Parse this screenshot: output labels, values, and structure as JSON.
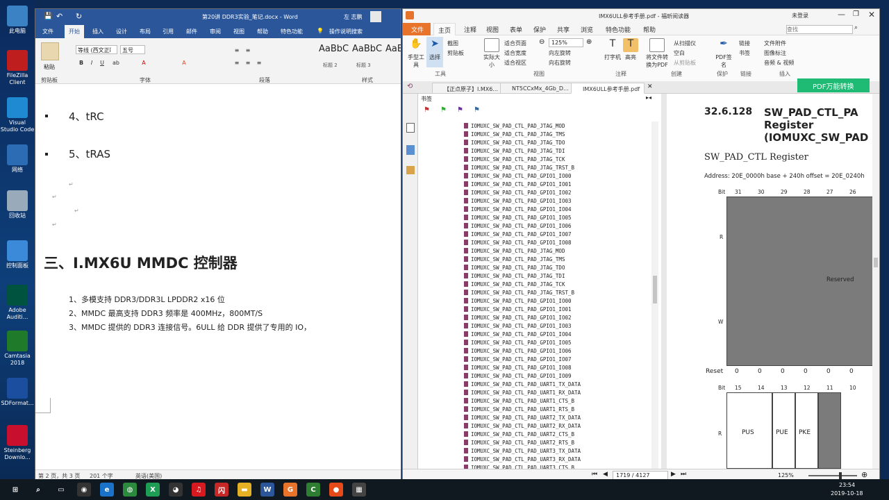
{
  "desktop": {
    "icons": [
      {
        "label": "此电脑",
        "icon": "computer-icon",
        "color": "#3b82c4"
      },
      {
        "label": "FileZilla Client",
        "icon": "filezilla-icon",
        "color": "#bf1e1e"
      },
      {
        "label": "Visual Studio Code",
        "icon": "vscode-icon",
        "color": "#1f8ad2"
      },
      {
        "label": "网络",
        "icon": "network-icon",
        "color": "#2b6cb5"
      },
      {
        "label": "回收站",
        "icon": "recycle-bin-icon",
        "color": "#9ab"
      },
      {
        "label": "控制面板",
        "icon": "control-panel-icon",
        "color": "#3a8ad9"
      },
      {
        "label": "Adobe Auditi...",
        "icon": "audition-icon",
        "color": "#00543f"
      },
      {
        "label": "Camtasia 2018",
        "icon": "camtasia-icon",
        "color": "#1f7a2a"
      },
      {
        "label": "SDFormat...",
        "icon": "sdformatter-icon",
        "color": "#1c4ea0"
      },
      {
        "label": "Steinberg Downlo...",
        "icon": "steinberg-icon",
        "color": "#c8102e"
      }
    ]
  },
  "word": {
    "title": "第20讲 DDR3实验_笔记.docx - Word",
    "user": "左 志鹏",
    "tabs": [
      "文件",
      "开始",
      "插入",
      "设计",
      "布局",
      "引用",
      "邮件",
      "审阅",
      "视图",
      "帮助",
      "特色功能"
    ],
    "tell_me": "操作说明搜索",
    "ribbon": {
      "paste_label": "粘贴",
      "clipboard_group": "剪贴板",
      "font_name": "等线 (西文正ǐ",
      "font_size": "五号",
      "font_group": "字体",
      "paragraph_group": "段落",
      "styles_group": "样式",
      "styles": [
        {
          "preview": "AaBbC",
          "name": "标题 2"
        },
        {
          "preview": "AaBbC",
          "name": "标题 3"
        },
        {
          "preview": "AaBb",
          "name": ""
        }
      ]
    },
    "doc": {
      "item4": "4、tRC",
      "item5": "5、tRAS",
      "heading": "三、I.MX6U MMDC 控制器",
      "line1": "1、多模支持 DDR3/DDR3L LPDDR2 x16 位",
      "line2": "2、MMDC 最高支持 DDR3 频率是 400MHz，800MT/S",
      "line3": "3、MMDC 提供的 DDR3 连接信号。6ULL 给 DDR 提供了专用的 IO，"
    },
    "status": {
      "page": "第 2 页，共 3 页",
      "words": "201 个字",
      "lang": "英语(美国)"
    }
  },
  "foxit": {
    "title": "IMX6ULL参考手册.pdf - 福昕阅读器",
    "login": "未登录",
    "menu": [
      "文件",
      "主页",
      "注释",
      "视图",
      "表单",
      "保护",
      "共享",
      "浏览",
      "特色功能",
      "帮助"
    ],
    "search_placeholder": "查找",
    "ribbon": {
      "hand": "手型工具",
      "select": "选择",
      "screenshot": "截图",
      "clipboard": "剪贴板",
      "actual_size": "实际大小",
      "fit_page": "适合页面",
      "fit_width": "适合宽度",
      "fit_view": "适合视区",
      "zoom": "125%",
      "rotate_left": "向左旋转",
      "rotate_right": "向右旋转",
      "typewriter": "打字机",
      "highlight": "高亮",
      "to_pdf": "将文件转换为PDF",
      "from_scanner": "从扫描仪",
      "blank": "空白",
      "from_clipboard": "从剪贴板",
      "pdf_sign": "PDF签名",
      "link": "链接",
      "bookmark": "书签",
      "file_attach": "文件附件",
      "image_annot": "图像标注",
      "audio_video": "音频 & 视频",
      "groups": [
        "工具",
        "视图",
        "注释",
        "创建",
        "保护",
        "链接",
        "插入"
      ]
    },
    "doc_tabs": [
      "【正点原子】I.MX6...",
      "NT5CCxMx_4Gb_D...",
      "IMX6ULL参考手册.pdf"
    ],
    "convert_button": "PDF万能转换",
    "bookmarks_label": "书签",
    "bookmarks": [
      "IOMUXC_SW_PAD_CTL_PAD_JTAG_MOD",
      "IOMUXC_SW_PAD_CTL_PAD_JTAG_TMS",
      "IOMUXC_SW_PAD_CTL_PAD_JTAG_TDO",
      "IOMUXC_SW_PAD_CTL_PAD_JTAG_TDI",
      "IOMUXC_SW_PAD_CTL_PAD_JTAG_TCK",
      "IOMUXC_SW_PAD_CTL_PAD_JTAG_TRST_B",
      "IOMUXC_SW_PAD_CTL_PAD_GPIO1_IO00",
      "IOMUXC_SW_PAD_CTL_PAD_GPIO1_IO01",
      "IOMUXC_SW_PAD_CTL_PAD_GPIO1_IO02",
      "IOMUXC_SW_PAD_CTL_PAD_GPIO1_IO03",
      "IOMUXC_SW_PAD_CTL_PAD_GPIO1_IO04",
      "IOMUXC_SW_PAD_CTL_PAD_GPIO1_IO05",
      "IOMUXC_SW_PAD_CTL_PAD_GPIO1_IO06",
      "IOMUXC_SW_PAD_CTL_PAD_GPIO1_IO07",
      "IOMUXC_SW_PAD_CTL_PAD_GPIO1_IO08",
      "IOMUXC_SW_PAD_CTL_PAD_JTAG_MOD",
      "IOMUXC_SW_PAD_CTL_PAD_JTAG_TMS",
      "IOMUXC_SW_PAD_CTL_PAD_JTAG_TDO",
      "IOMUXC_SW_PAD_CTL_PAD_JTAG_TDI",
      "IOMUXC_SW_PAD_CTL_PAD_JTAG_TCK",
      "IOMUXC_SW_PAD_CTL_PAD_JTAG_TRST_B",
      "IOMUXC_SW_PAD_CTL_PAD_GPIO1_IO00",
      "IOMUXC_SW_PAD_CTL_PAD_GPIO1_IO01",
      "IOMUXC_SW_PAD_CTL_PAD_GPIO1_IO02",
      "IOMUXC_SW_PAD_CTL_PAD_GPIO1_IO03",
      "IOMUXC_SW_PAD_CTL_PAD_GPIO1_IO04",
      "IOMUXC_SW_PAD_CTL_PAD_GPIO1_IO05",
      "IOMUXC_SW_PAD_CTL_PAD_GPIO1_IO06",
      "IOMUXC_SW_PAD_CTL_PAD_GPIO1_IO07",
      "IOMUXC_SW_PAD_CTL_PAD_GPIO1_IO08",
      "IOMUXC_SW_PAD_CTL_PAD_GPIO1_IO09",
      "IOMUXC_SW_PAD_CTL_PAD_UART1_TX_DATA",
      "IOMUXC_SW_PAD_CTL_PAD_UART1_RX_DATA",
      "IOMUXC_SW_PAD_CTL_PAD_UART1_CTS_B",
      "IOMUXC_SW_PAD_CTL_PAD_UART1_RTS_B",
      "IOMUXC_SW_PAD_CTL_PAD_UART2_TX_DATA",
      "IOMUXC_SW_PAD_CTL_PAD_UART2_RX_DATA",
      "IOMUXC_SW_PAD_CTL_PAD_UART2_CTS_B",
      "IOMUXC_SW_PAD_CTL_PAD_UART2_RTS_B",
      "IOMUXC_SW_PAD_CTL_PAD_UART3_TX_DATA",
      "IOMUXC_SW_PAD_CTL_PAD_UART3_RX_DATA",
      "IOMUXC_SW_PAD_CTL_PAD_UART3_CTS_B"
    ],
    "page": {
      "section": "32.6.128",
      "title_l1": "SW_PAD_CTL_PA",
      "title_l2": "Register",
      "title_l3": "(IOMUXC_SW_PAD",
      "subtitle": "SW_PAD_CTL Register",
      "address": "Address: 20E_0000h base + 240h offset = 20E_0240h",
      "bit_label": "Bit",
      "bits_top": [
        "31",
        "30",
        "29",
        "28",
        "27",
        "26"
      ],
      "r_label": "R",
      "w_label": "W",
      "reserved": "Reserved",
      "reset_label": "Reset",
      "reset_values": [
        "0",
        "0",
        "0",
        "0",
        "0",
        "0"
      ],
      "bits_bottom": [
        "15",
        "14",
        "13",
        "12",
        "11",
        "10"
      ],
      "fields": [
        "PUS",
        "PUE",
        "PKE"
      ]
    },
    "status": {
      "page_indicator": "1719 / 4127",
      "zoom": "125%"
    }
  },
  "taskbar": {
    "time": "23:54",
    "date": "2019-10-18",
    "apps": [
      {
        "icon": "start-icon",
        "color": "#101820"
      },
      {
        "icon": "search-icon",
        "color": "#101820"
      },
      {
        "icon": "task-view-icon",
        "color": "#101820"
      },
      {
        "icon": "camera-app-icon",
        "color": "#333"
      },
      {
        "icon": "edge-icon",
        "color": "#1a73c8"
      },
      {
        "icon": "chrome-icon",
        "color": "#2b8a3e"
      },
      {
        "icon": "xshell-icon",
        "color": "#1f9d55"
      },
      {
        "icon": "qq-icon",
        "color": "#333"
      },
      {
        "icon": "netease-music-icon",
        "color": "#d71920"
      },
      {
        "icon": "shanyan-icon",
        "color": "#c62828"
      },
      {
        "icon": "file-explorer-icon",
        "color": "#e5b024"
      },
      {
        "icon": "word-icon",
        "color": "#2b579a"
      },
      {
        "icon": "foxit-icon",
        "color": "#e8732b"
      },
      {
        "icon": "camtasia-task-icon",
        "color": "#2e7d32"
      },
      {
        "icon": "camtasia-rec-icon",
        "color": "#e64a19"
      },
      {
        "icon": "calculator-icon",
        "color": "#444"
      }
    ]
  }
}
